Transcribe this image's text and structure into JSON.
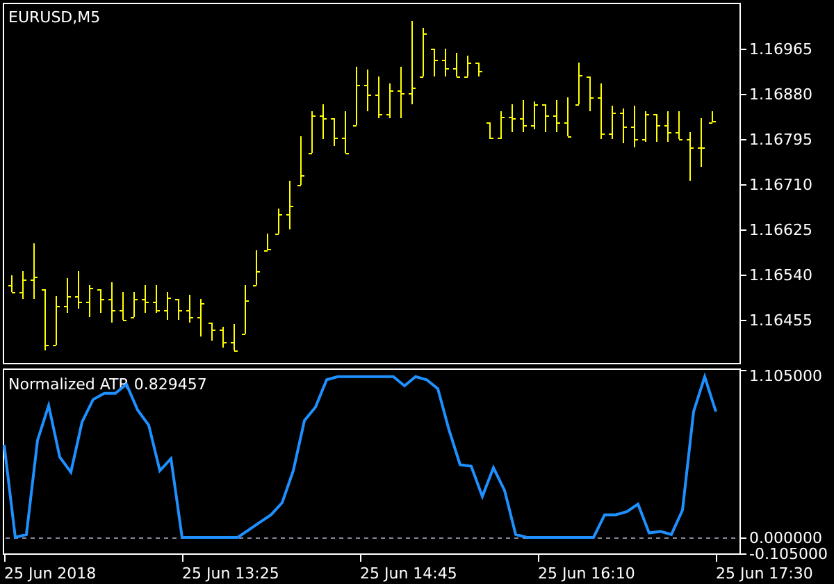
{
  "price_chart": {
    "title": "EURUSD,M5",
    "price_labels": [
      "1.16965",
      "1.16880",
      "1.16795",
      "1.16710",
      "1.16625",
      "1.16540",
      "1.16455"
    ]
  },
  "indicator": {
    "chart_data": {
      "type": "line",
      "title": "Normalized ATR 0.829457",
      "ylim": [
        -0.105,
        1.105
      ],
      "yticks": [
        {
          "value": 1.105,
          "label": "1.105000"
        },
        {
          "value": 0,
          "label": "0.000000"
        },
        {
          "value": -0.105,
          "label": "-0.105000"
        }
      ],
      "series": [
        {
          "color": "#1e90ff",
          "values": [
            0.61,
            0,
            0.02,
            0.64,
            0.87,
            0.53,
            0.43,
            0.76,
            0.91,
            0.95,
            0.95,
            1.01,
            0.84,
            0.74,
            0.44,
            0.52,
            0,
            0,
            0,
            0,
            0,
            0,
            0.05,
            0.1,
            0.15,
            0.23,
            0.44,
            0.77,
            0.86,
            1.04,
            1.06,
            1.06,
            1.06,
            1.06,
            1.06,
            1.06,
            1.0,
            1.06,
            1.04,
            0.98,
            0.71,
            0.48,
            0.47,
            0.27,
            0.46,
            0.31,
            0.02,
            0,
            0,
            0,
            0,
            0,
            0,
            0,
            0.15,
            0.15,
            0.17,
            0.22,
            0.03,
            0.04,
            0.02,
            0.18,
            0.83,
            1.06,
            0.83
          ]
        }
      ]
    }
  },
  "time_axis": {
    "labels": [
      "25 Jun 2018",
      "25 Jun 13:25",
      "25 Jun 14:45",
      "25 Jun 16:10",
      "25 Jun 17:30"
    ]
  }
}
